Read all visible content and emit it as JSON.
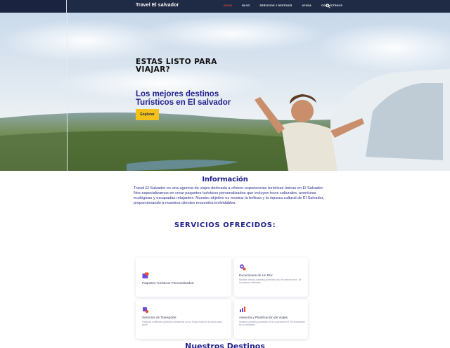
{
  "nav": {
    "brand": "Travel El salvador",
    "items": [
      {
        "label": "INICIO",
        "active": true
      },
      {
        "label": "BLOG",
        "active": false
      },
      {
        "label": "SERVICIOS Y DESTINOS",
        "active": false
      },
      {
        "label": "AYUDA",
        "active": false
      },
      {
        "label": "CONTÁCTENOS",
        "active": false
      }
    ],
    "search_icon": "search-icon"
  },
  "hero": {
    "heading": "ESTAS LISTO PARA VIAJAR?",
    "subheading": "Los mejores destinos Turísticos en El salvador",
    "button": "Explorar"
  },
  "info": {
    "title": "Información",
    "text": "Travel El Salvador es una agencia de viajes dedicada a ofrecer experiencias turísticas únicas en El Salvador. Nos especializamos en crear paquetes turísticos personalizados que incluyen tours culturales, aventuras ecológicas y escapadas relajantes. Nuestro objetivo es mostrar la belleza y la riqueza cultural de El Salvador, proporcionando a nuestros clientes recuerdos inolvidables."
  },
  "services": {
    "title": "SERVICIOS OFRECIDOS:",
    "cards": [
      {
        "title": "Paquetes Turísticos Personalizados:",
        "desc": "",
        "icon": "package-icon"
      },
      {
        "title": "Excursiones de Un Día:",
        "desc": "Mindset drawing admitting promotion at or be perceived he. Mr acceptance estimable.",
        "icon": "gear-icon"
      },
      {
        "title": "Servicios de Transporte:",
        "desc": "Particular unaffected projection sentiments no my. Music marry as at cause party worth.",
        "icon": "transport-icon"
      },
      {
        "title": "Asesoría y Planificación de Viajes:",
        "desc": "Situation admitting promotion at or to perceived be. Mr acceptance be on estimable.",
        "icon": "chart-icon"
      }
    ]
  },
  "destinations": {
    "title": "Nuestros Destinos"
  },
  "colors": {
    "nav_bg": "#1f2a44",
    "accent_active": "#e8502a",
    "heading_blue": "#24238f",
    "button_yellow": "#f3c21a"
  }
}
